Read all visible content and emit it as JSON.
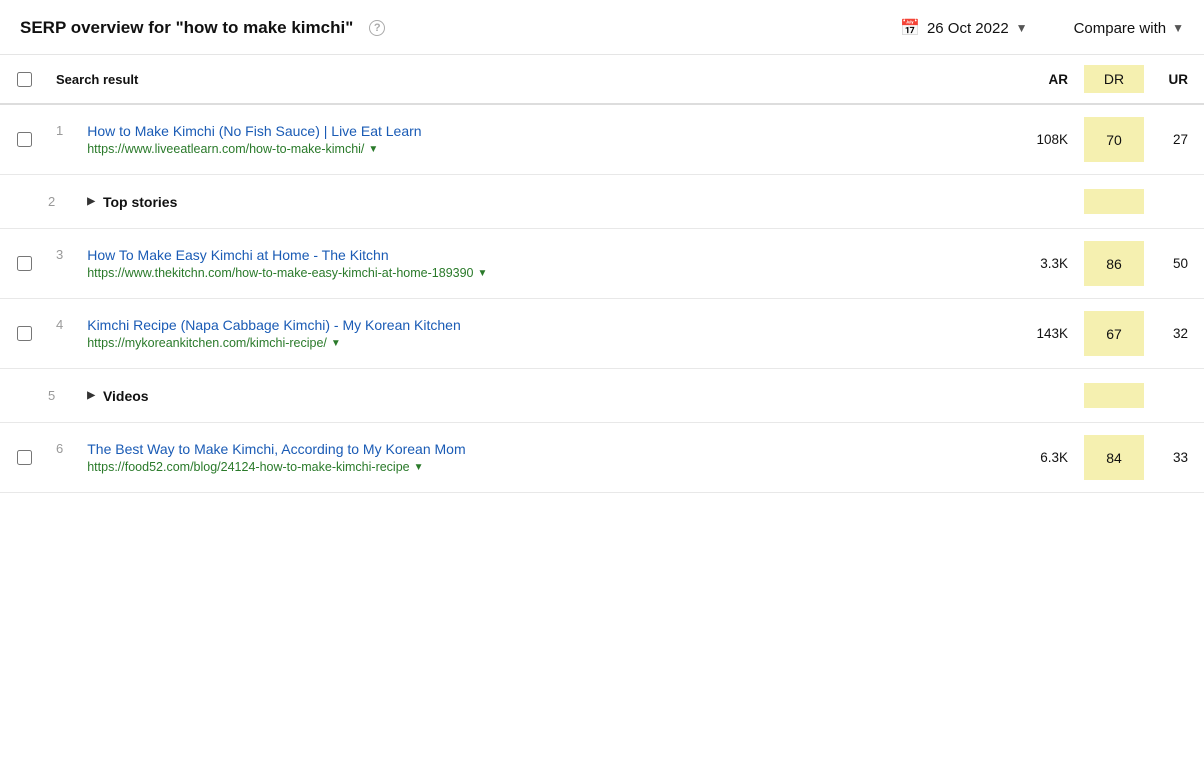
{
  "header": {
    "title_prefix": "SERP overview for ",
    "title_keyword": "\"how to make kimchi\"",
    "date": "26 Oct 2022",
    "compare_with": "Compare with",
    "help_tooltip": "?"
  },
  "table": {
    "columns": {
      "search_result": "Search result",
      "ar": "AR",
      "dr": "DR",
      "ur": "UR"
    },
    "rows": [
      {
        "type": "result",
        "num": "1",
        "title": "How to Make Kimchi (No Fish Sauce) | Live Eat Learn",
        "url": "https://www.liveeatlearn.com/how-to-make-kimchi/",
        "ar": "108K",
        "dr": "70",
        "ur": "27",
        "has_url_dropdown": true
      },
      {
        "type": "expand",
        "num": "2",
        "label": "Top stories"
      },
      {
        "type": "result",
        "num": "3",
        "title": "How To Make Easy Kimchi at Home - The Kitchn",
        "url": "https://www.thekitchn.com/how-to-make-easy-kimchi-at-home-189390",
        "ar": "3.3K",
        "dr": "86",
        "ur": "50",
        "has_url_dropdown": true
      },
      {
        "type": "result",
        "num": "4",
        "title": "Kimchi Recipe (Napa Cabbage Kimchi) - My Korean Kitchen",
        "url": "https://mykoreankitchen.com/kimchi-recipe/",
        "ar": "143K",
        "dr": "67",
        "ur": "32",
        "has_url_dropdown": true
      },
      {
        "type": "expand",
        "num": "5",
        "label": "Videos"
      },
      {
        "type": "result",
        "num": "6",
        "title": "The Best Way to Make Kimchi, According to My Korean Mom",
        "url": "https://food52.com/blog/24124-how-to-make-kimchi-recipe",
        "ar": "6.3K",
        "dr": "84",
        "ur": "33",
        "has_url_dropdown": true
      }
    ]
  }
}
